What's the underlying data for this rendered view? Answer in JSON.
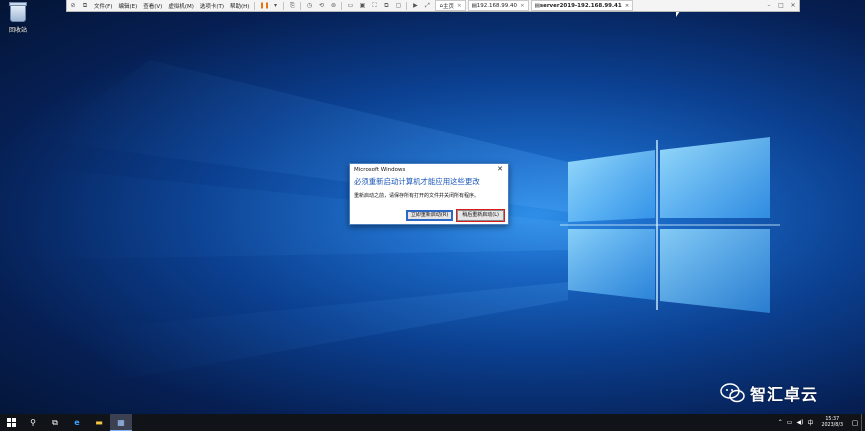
{
  "desktop": {
    "recycle_bin_label": "回收站"
  },
  "vm_toolbar": {
    "menus": [
      "文件(F)",
      "编辑(E)",
      "查看(V)",
      "虚拟机(M)",
      "选项卡(T)",
      "帮助(H)"
    ],
    "tabs": [
      {
        "label": "主页"
      },
      {
        "label": "192.168.99.40"
      },
      {
        "label": "server2019-192.168.99.41"
      }
    ]
  },
  "dialog": {
    "title": "Microsoft Windows",
    "heading": "必须重新启动计算机才能应用这些更改",
    "body": "重新启动之前，请保存所有打开的文件并关闭所有程序。",
    "restart_now_label": "立即重新启动(R)",
    "restart_later_label": "稍后重新启动(L)"
  },
  "taskbar": {
    "time": "15:37",
    "date": "2023/8/3",
    "ime": "中"
  },
  "watermark": {
    "text": "智汇卓云"
  }
}
